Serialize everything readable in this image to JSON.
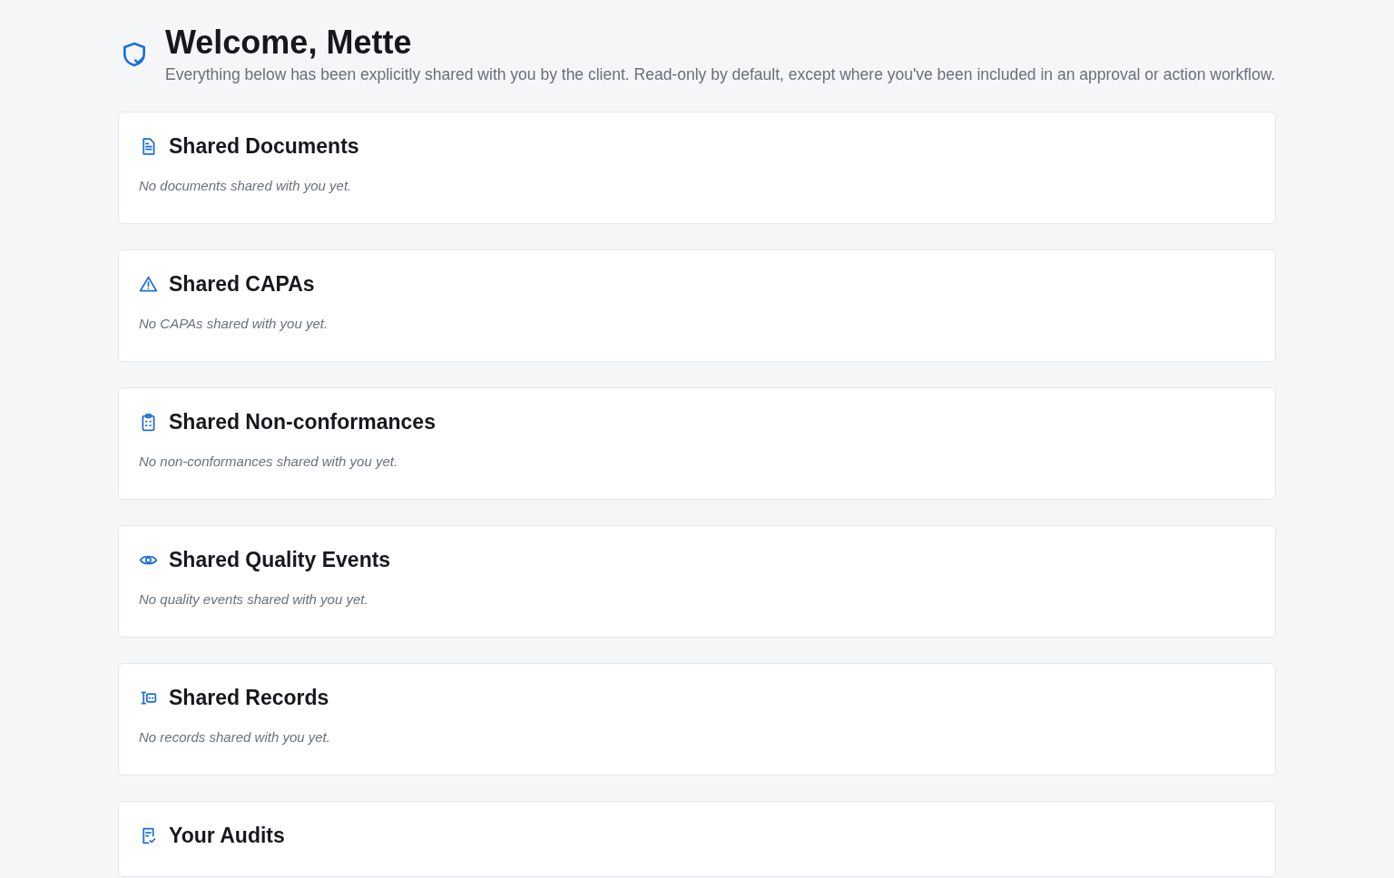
{
  "header": {
    "title": "Welcome, Mette",
    "subtitle": "Everything below has been explicitly shared with you by the client. Read-only by default, except where you've been included in an approval or action workflow."
  },
  "sections": [
    {
      "kind": "document",
      "title": "Shared Documents",
      "empty_text": "No documents shared with you yet."
    },
    {
      "kind": "warning",
      "title": "Shared CAPAs",
      "empty_text": "No CAPAs shared with you yet."
    },
    {
      "kind": "clipboard",
      "title": "Shared Non-conformances",
      "empty_text": "No non-conformances shared with you yet."
    },
    {
      "kind": "eye",
      "title": "Shared Quality Events",
      "empty_text": "No quality events shared with you yet."
    },
    {
      "kind": "records",
      "title": "Shared Records",
      "empty_text": "No records shared with you yet."
    },
    {
      "kind": "audit",
      "title": "Your Audits"
    }
  ]
}
